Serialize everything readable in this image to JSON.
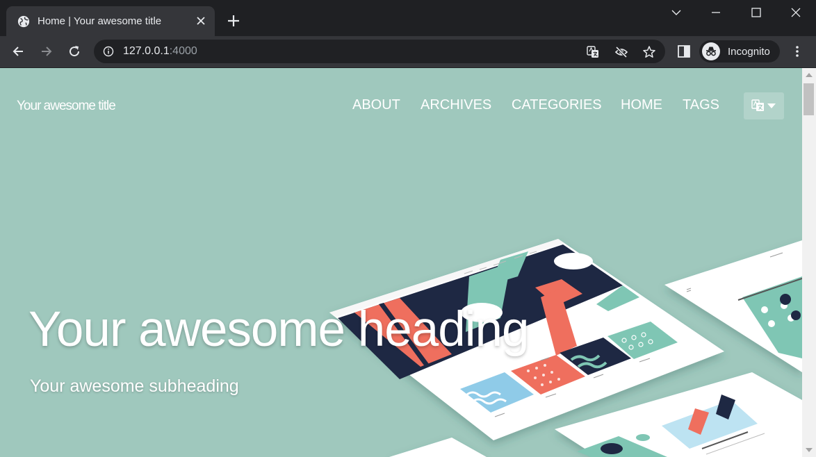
{
  "browser": {
    "tab_title": "Home | Your awesome title",
    "url_host": "127.0.0.1",
    "url_port": ":4000",
    "profile_label": "Incognito"
  },
  "site": {
    "brand": "Your awesome title",
    "nav": [
      {
        "label": "ABOUT"
      },
      {
        "label": "ARCHIVES"
      },
      {
        "label": "CATEGORIES"
      },
      {
        "label": "HOME"
      },
      {
        "label": "TAGS"
      }
    ],
    "hero": {
      "heading": "Your awesome heading",
      "subheading": "Your awesome subheading"
    }
  },
  "colors": {
    "hero_background": "#9fc8bd",
    "chrome_dark": "#35363a",
    "accent_coral": "#ef6f5e",
    "accent_navy": "#1e2843",
    "accent_mint": "#7fc6b4"
  }
}
